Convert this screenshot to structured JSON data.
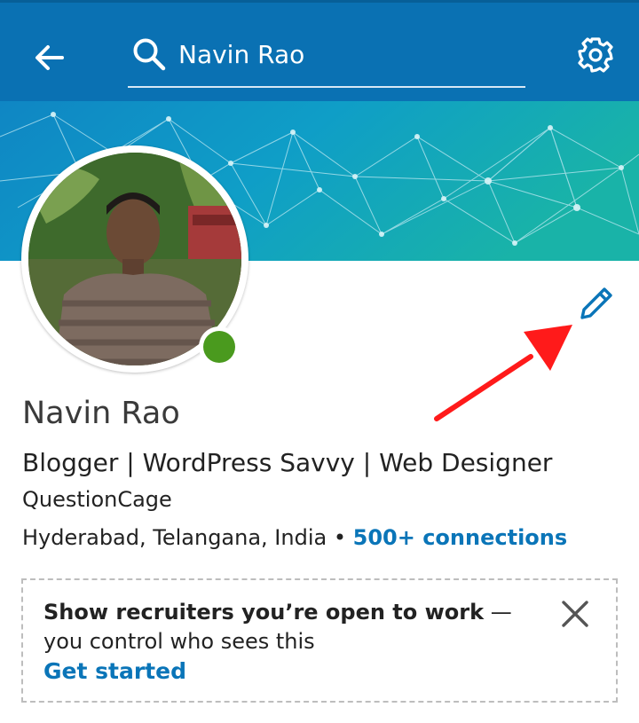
{
  "header": {
    "search_value": "Navin Rao",
    "search_placeholder": "Search",
    "back_icon": "arrow-left-icon",
    "settings_icon": "gear-icon"
  },
  "profile": {
    "name": "Navin Rao",
    "headline": "Blogger | WordPress Savvy | Web Designer",
    "company": "QuestionCage",
    "location": "Hyderabad, Telangana, India",
    "separator": " • ",
    "connections": "500+ connections",
    "status": "online",
    "edit_icon": "pencil-icon"
  },
  "open_to_work": {
    "title": "Show recruiters you’re open to work",
    "rest": " — you control who sees this",
    "cta": "Get started",
    "close_icon": "close-icon"
  },
  "colors": {
    "brand": "#0a71b3",
    "link": "#0a75b8",
    "online": "#4a9a1e",
    "annotation": "#ff1a1a"
  }
}
